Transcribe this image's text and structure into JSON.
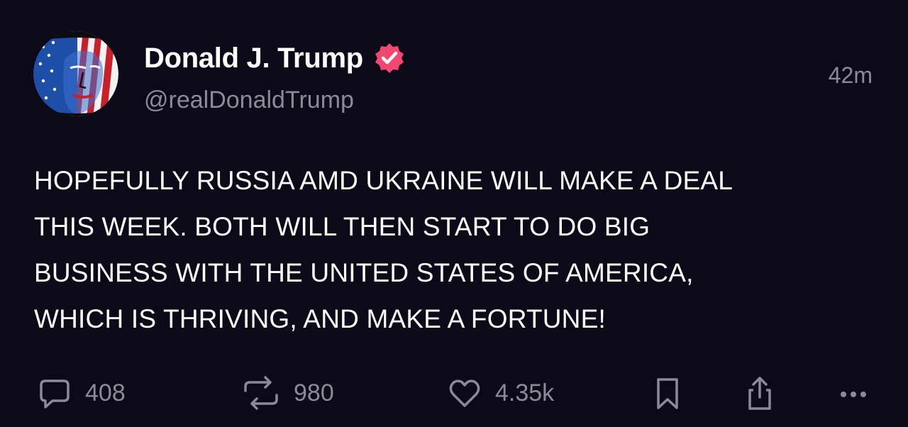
{
  "post": {
    "display_name": "Donald J. Trump",
    "handle": "@realDonaldTrump",
    "timestamp": "42m",
    "text": "HOPEFULLY RUSSIA AMD UKRAINE WILL MAKE A DEAL\nTHIS WEEK. BOTH WILL THEN START TO DO BIG\nBUSINESS WITH THE UNITED STATES OF AMERICA,\nWHICH IS THRIVING, AND MAKE A FORTUNE!",
    "verified": true
  },
  "actions": {
    "replies": "408",
    "reposts": "980",
    "likes": "4.35k"
  },
  "icons": {
    "reply": "speech-bubble-icon",
    "repost": "repost-arrows-icon",
    "like": "heart-icon",
    "bookmark": "bookmark-icon",
    "share": "share-icon",
    "more": "more-dots-icon",
    "verified": "verified-badge-icon"
  },
  "colors": {
    "background": "#0c0a18",
    "text": "#ffffff",
    "muted": "#8c8a9a",
    "verified_badge": "#f2476e"
  }
}
